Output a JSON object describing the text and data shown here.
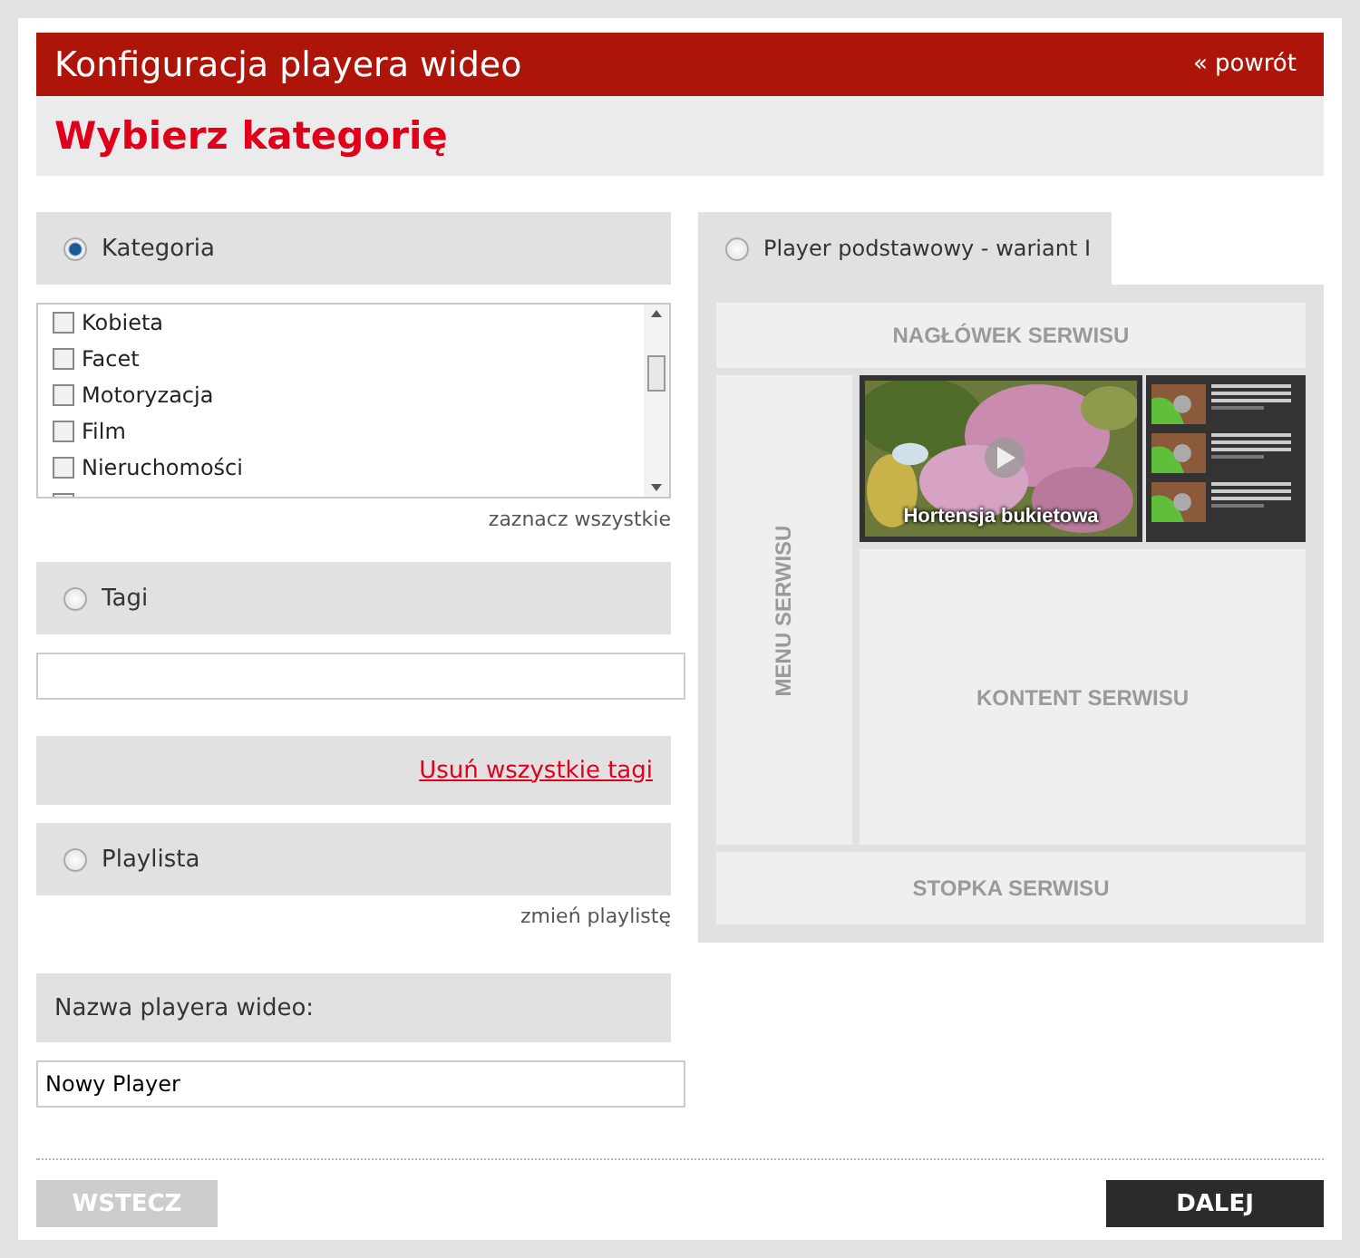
{
  "header": {
    "title": "Konfiguracja playera wideo",
    "back_link": "« powrót"
  },
  "subtitle": "Wybierz kategorię",
  "sources": [
    {
      "kind": "categories",
      "label": "Kategoria",
      "selected": true
    },
    {
      "kind": "tags",
      "label": "Tagi",
      "selected": false
    },
    {
      "kind": "playlist",
      "label": "Playlista",
      "selected": false
    }
  ],
  "categories": [
    {
      "label": "Kobieta",
      "checked": false
    },
    {
      "label": "Facet",
      "checked": false
    },
    {
      "label": "Motoryzacja",
      "checked": false
    },
    {
      "label": "Film",
      "checked": false
    },
    {
      "label": "Nieruchomości",
      "checked": false
    }
  ],
  "select_all": "zaznacz wszystkie",
  "remove_tags": "Usuń wszystkie tagi",
  "change_playlist": "zmień playlistę",
  "name_label": "Nazwa playera wideo:",
  "name_value": "Nowy Player",
  "variant": {
    "label": "Player podstawowy - wariant I",
    "selected": false
  },
  "layout": {
    "header": "NAGŁÓWEK SERWISU",
    "menu": "MENU SERWISU",
    "content": "KONTENT SERWISU",
    "footer": "STOPKA SERWISU",
    "video_caption": "Hortensja bukietowa"
  },
  "buttons": {
    "back": "WSTECZ",
    "next": "DALEJ"
  }
}
